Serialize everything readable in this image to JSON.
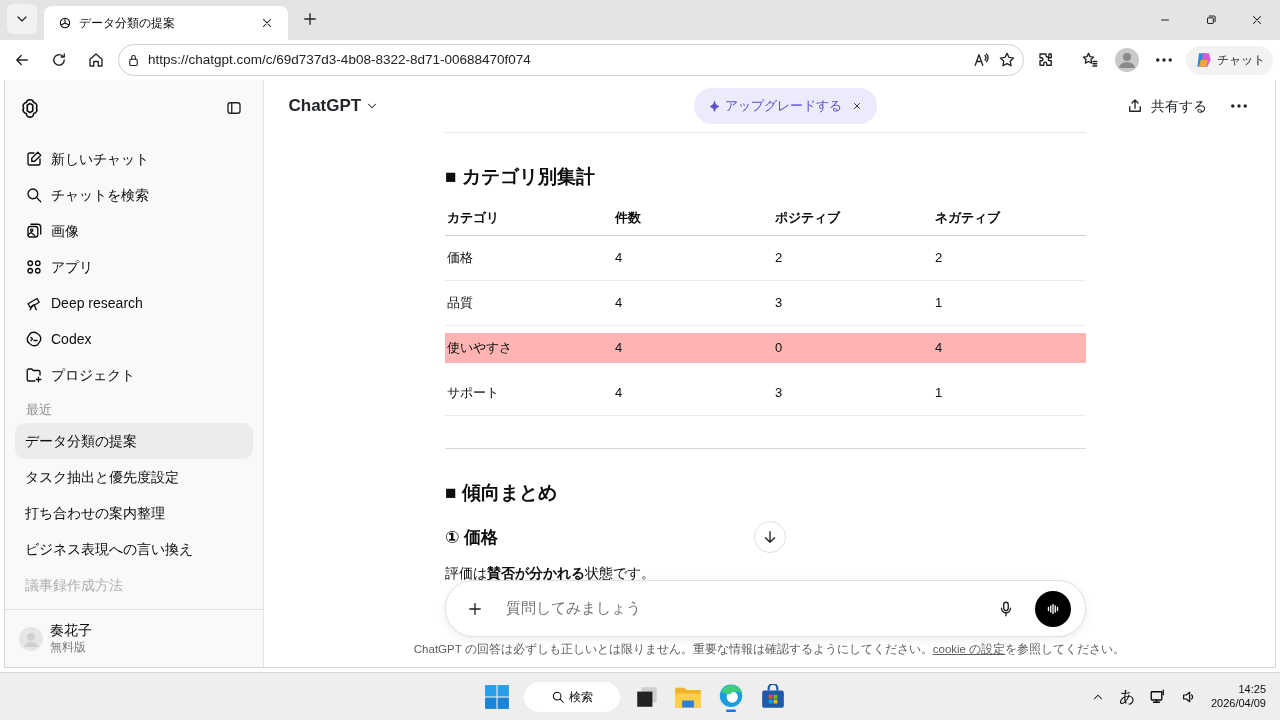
{
  "browser": {
    "tab_title": "データ分類の提案",
    "url": "https://chatgpt.com/c/69d737d3-4b08-8322-8d71-00688470f074",
    "copilot_label": "チャット"
  },
  "sidebar": {
    "nav_items": [
      {
        "label": "新しいチャット"
      },
      {
        "label": "チャットを検索"
      },
      {
        "label": "画像"
      },
      {
        "label": "アプリ"
      },
      {
        "label": "Deep research"
      },
      {
        "label": "Codex"
      },
      {
        "label": "プロジェクト"
      }
    ],
    "recent_heading": "最近",
    "recent": [
      {
        "label": "データ分類の提案",
        "selected": true,
        "faded": false
      },
      {
        "label": "タスク抽出と優先度設定",
        "selected": false,
        "faded": false
      },
      {
        "label": "打ち合わせの案内整理",
        "selected": false,
        "faded": false
      },
      {
        "label": "ビジネス表現への言い換え",
        "selected": false,
        "faded": false
      },
      {
        "label": "議事録作成方法",
        "selected": false,
        "faded": true
      }
    ],
    "user": {
      "name": "奏花子",
      "plan": "無料版"
    }
  },
  "header": {
    "title": "ChatGPT",
    "upgrade": "アップグレードする",
    "share": "共有する"
  },
  "content": {
    "section_heading": "■ カテゴリ別集計",
    "table": {
      "columns": [
        "カテゴリ",
        "件数",
        "ポジティブ",
        "ネガティブ"
      ],
      "rows": [
        {
          "cells": [
            "価格",
            "4",
            "2",
            "2"
          ],
          "highlighted": false
        },
        {
          "cells": [
            "品質",
            "4",
            "3",
            "1"
          ],
          "highlighted": false
        },
        {
          "cells": [
            "使いやすさ",
            "4",
            "0",
            "4"
          ],
          "highlighted": true
        },
        {
          "cells": [
            "サポート",
            "4",
            "3",
            "1"
          ],
          "highlighted": false
        }
      ]
    },
    "summary_heading": "■ 傾向まとめ",
    "sub_heading": "① 価格",
    "paragraph": "評価は**賛否が分かれる**状態です。"
  },
  "composer": {
    "placeholder": "質問してみましょう"
  },
  "disclaimer": {
    "text": "ChatGPT の回答は必ずしも正しいとは限りません。重要な情報は確認するようにしてください。",
    "link": "cookie の設定",
    "suffix": "を参照してください。"
  },
  "taskbar": {
    "search": "検索",
    "ime": "あ",
    "time": "14:25",
    "date": "2026/04/09"
  }
}
